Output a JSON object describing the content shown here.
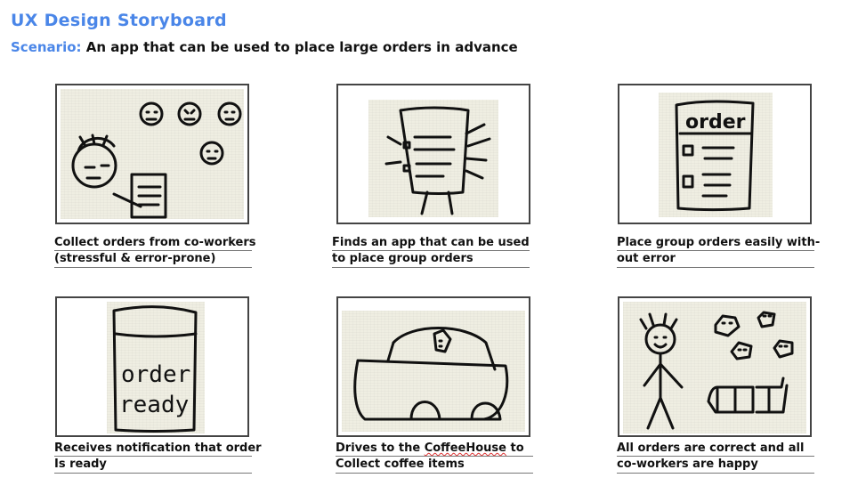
{
  "header": {
    "title": "UX Design Storyboard",
    "scenario_label": "Scenario:",
    "scenario_text": "An app that can be used to place large orders in advance"
  },
  "panels": [
    {
      "line1": "Collect orders from co-workers",
      "line2": "(stressful & error-prone)"
    },
    {
      "line1": "Finds an app that can be used",
      "line2": "to place group orders"
    },
    {
      "line1": "Place group orders easily with-",
      "line2": "out error"
    },
    {
      "line1": "Receives notification that order",
      "line2": "Is ready"
    },
    {
      "line1_pre": "Drives to the ",
      "line1_brand": "CoffeeHouse",
      "line1_post": " to",
      "line2": "Collect coffee items"
    },
    {
      "line1": "All orders are correct and all",
      "line2": "co-workers are happy"
    }
  ],
  "sketch_text": {
    "phone_header": "order",
    "notification": [
      "order",
      "ready"
    ]
  }
}
